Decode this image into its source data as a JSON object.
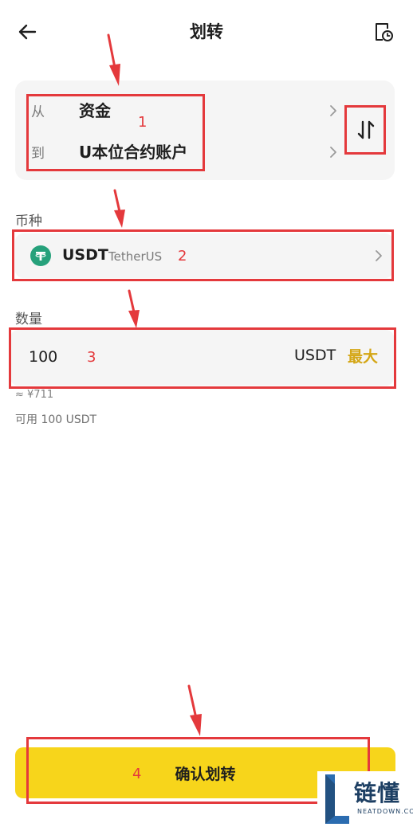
{
  "header": {
    "title": "划转"
  },
  "transfer": {
    "from_label": "从",
    "from_value": "资金",
    "to_label": "到",
    "to_value": "U本位合约账户"
  },
  "coin": {
    "section_label": "币种",
    "symbol": "USDT",
    "name": "TetherUS"
  },
  "amount": {
    "section_label": "数量",
    "value": "100",
    "unit": "USDT",
    "max_label": "最大",
    "fiat_estimate": "≈ ¥711",
    "available": "可用 100 USDT"
  },
  "confirm": {
    "label": "确认划转"
  },
  "annotations": [
    "1",
    "2",
    "3",
    "4"
  ],
  "watermark": {
    "text": "链懂",
    "sub": "NEATDOWN.COM"
  },
  "colors": {
    "accent_yellow": "#f7d51b",
    "max_gold": "#d4a615",
    "annotation_red": "#e4393c",
    "tether_teal": "#26a17b"
  },
  "icons": {
    "back": "arrow-left-icon",
    "history": "history-document-icon",
    "swap": "swap-vertical-icon",
    "chevron": "chevron-right-icon",
    "coin": "tether-logo-icon"
  }
}
